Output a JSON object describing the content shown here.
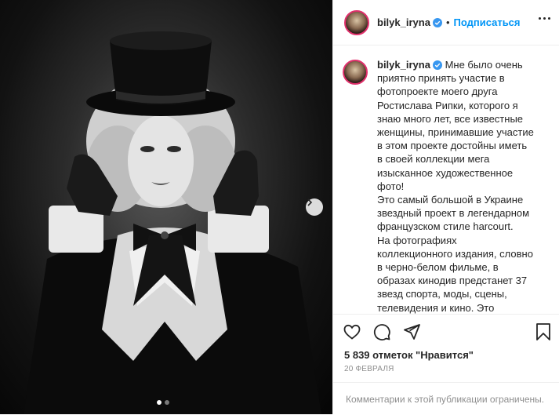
{
  "post": {
    "username": "bilyk_iryna",
    "follow_label": "Подписаться",
    "separator": "•",
    "caption": "Мне было очень приятно принять участие в фотопроекте моего друга Ростислава Рипки, которого я знаю много лет, все известные женщины, принимавшие участие в этом проекте достойны иметь в своей коллекции мега изысканное художественное фото!\nЭто самый большой в Украине звездный проект в легендарном французском стиле harcourt.\nНа фотографиях коллекционного издания, словно в черно-белом фильме, в образах кинодив предстанет 37 звезд спорта, моды, сцены, телевидения и кино. Это сильные и талантливые женщины, которые вдохновляют миллионы украинцев.\nПроект был воплощен благодаря",
    "likes": "5 839 отметок \"Нравится\"",
    "date": "20 ФЕВРАЛЯ",
    "comments_restricted": "Комментарии к этой публикации ограничены."
  },
  "carousel": {
    "slide_count": 2,
    "active_index": 0
  },
  "icons": {
    "like": "heart-icon",
    "comment": "comment-icon",
    "share": "share-icon",
    "save": "bookmark-icon",
    "next": "chevron-right-icon",
    "verified": "verified-badge-icon",
    "more": "more-options-icon"
  },
  "colors": {
    "accent": "#0095f6",
    "verified": "#3897f0",
    "text": "#262626",
    "muted": "#8e8e8e",
    "border": "#efefef"
  }
}
